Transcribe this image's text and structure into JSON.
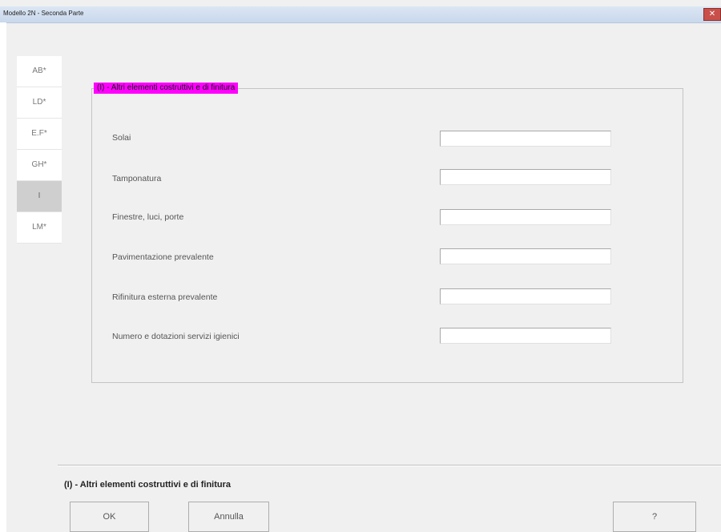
{
  "window": {
    "title": "Modello 2N - Seconda Parte",
    "close_glyph": "✕"
  },
  "tabs": [
    {
      "label": "AB*",
      "active": false
    },
    {
      "label": "LD*",
      "active": false
    },
    {
      "label": "E.F*",
      "active": false
    },
    {
      "label": "GH*",
      "active": false
    },
    {
      "label": "I",
      "active": true
    },
    {
      "label": "LM*",
      "active": false
    }
  ],
  "group": {
    "legend": "(I) - Altri elementi costruttivi e di finitura"
  },
  "fields": [
    {
      "label": "Solai",
      "value": ""
    },
    {
      "label": "Tamponatura",
      "value": ""
    },
    {
      "label": "Finestre, luci, porte",
      "value": ""
    },
    {
      "label": "Pavimentazione prevalente",
      "value": ""
    },
    {
      "label": "Rifinitura esterna prevalente",
      "value": ""
    },
    {
      "label": "Numero e dotazioni servizi igienici",
      "value": ""
    }
  ],
  "status": {
    "text": "(I) - Altri elementi costruttivi e di finitura"
  },
  "buttons": {
    "ok": "OK",
    "cancel": "Annulla",
    "help": "?"
  },
  "colors": {
    "legend_highlight": "#ff00ff",
    "active_tab": "#cfcfcf",
    "window_bg": "#f0f0f0"
  }
}
